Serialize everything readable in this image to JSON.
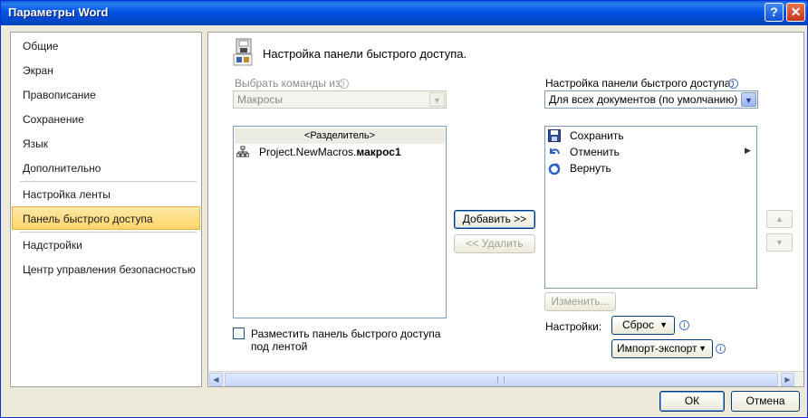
{
  "window": {
    "title": "Параметры Word",
    "help_glyph": "?",
    "close_glyph": "✕"
  },
  "sidebar": {
    "items": [
      {
        "label": "Общие"
      },
      {
        "label": "Экран"
      },
      {
        "label": "Правописание"
      },
      {
        "label": "Сохранение"
      },
      {
        "label": "Язык"
      },
      {
        "label": "Дополнительно"
      },
      {
        "label": "Настройка ленты"
      },
      {
        "label": "Панель быстрого доступа",
        "selected": true
      },
      {
        "label": "Надстройки"
      },
      {
        "label": "Центр управления безопасностью"
      }
    ]
  },
  "main": {
    "heading": "Настройка панели быстрого доступа.",
    "choose_label": "Выбрать команды из:",
    "choose_value": "Макросы",
    "customize_label": "Настройка панели быстрого доступа:",
    "customize_value": "Для всех документов (по умолчанию)",
    "left_list": {
      "separator": "<Разделитель>",
      "item_prefix": "Project.NewMacros.",
      "item_name": "макрос1"
    },
    "right_list": [
      {
        "label": "Сохранить",
        "icon": "save-icon"
      },
      {
        "label": "Отменить",
        "icon": "undo-icon"
      },
      {
        "label": "Вернуть",
        "icon": "redo-icon"
      }
    ],
    "add_button": "Добавить >>",
    "remove_button": "<< Удалить",
    "modify_button": "Изменить...",
    "checkbox_label": "Разместить панель быстрого доступа под лентой",
    "settings_label": "Настройки:",
    "reset_button": "Сброс",
    "import_export_button": "Импорт-экспорт"
  },
  "footer": {
    "ok": "ОК",
    "cancel": "Отмена"
  },
  "colors": {
    "title_bar": "#0055e5",
    "selected_nav": "#ffd56b"
  }
}
